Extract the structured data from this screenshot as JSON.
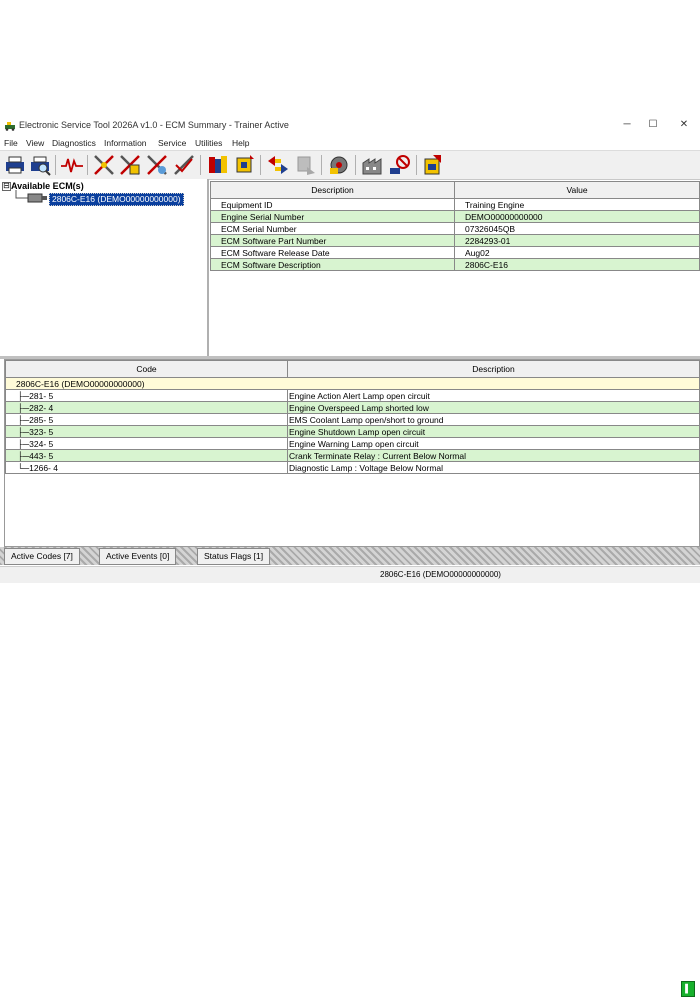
{
  "window": {
    "title": "Electronic Service Tool 2026A v1.0 - ECM Summary - Trainer Active",
    "min_glyph": "─",
    "max_glyph": "☐",
    "close_glyph": "✕"
  },
  "menu": [
    "File",
    "View",
    "Diagnostics",
    "Information",
    "Service",
    "Utilities",
    "Help"
  ],
  "toolbar_icons": [
    "printer-icon",
    "print-preview-icon",
    "waveform-icon",
    "diagnostic-tool-1-icon",
    "diagnostic-tool-2-icon",
    "diagnostic-tool-3-icon",
    "diagnostic-tool-4-icon",
    "books-icon",
    "chip-config-icon",
    "data-transfer-icon",
    "disabled-device-icon",
    "gear-settings-icon",
    "factory-icon",
    "no-entry-icon",
    "flash-file-icon"
  ],
  "tree": {
    "expander": "⊟",
    "root_label": "Available ECM(s)",
    "selected_label": "2806C-E16 (DEMO00000000000)"
  },
  "summary": {
    "headers": [
      "Description",
      "Value"
    ],
    "rows": [
      {
        "desc": "Equipment ID",
        "value": "Training Engine"
      },
      {
        "desc": "Engine Serial Number",
        "value": "DEMO00000000000"
      },
      {
        "desc": "ECM Serial Number",
        "value": "07326045QB"
      },
      {
        "desc": "ECM Software Part Number",
        "value": "2284293-01"
      },
      {
        "desc": "ECM Software Release Date",
        "value": "Aug02"
      },
      {
        "desc": "ECM Software Description",
        "value": "2806C-E16"
      }
    ]
  },
  "codes": {
    "headers": [
      "Code",
      "Description"
    ],
    "group": "2806C-E16 (DEMO00000000000)",
    "rows": [
      {
        "code": "281- 5",
        "desc": "Engine Action Alert Lamp open circuit"
      },
      {
        "code": "282- 4",
        "desc": "Engine Overspeed Lamp shorted low"
      },
      {
        "code": "285- 5",
        "desc": "EMS Coolant Lamp open/short to ground"
      },
      {
        "code": "323- 5",
        "desc": "Engine Shutdown Lamp open circuit"
      },
      {
        "code": "324- 5",
        "desc": "Engine Warning Lamp open circuit"
      },
      {
        "code": "443- 5",
        "desc": "Crank Terminate Relay : Current Below Normal"
      },
      {
        "code": "1266- 4",
        "desc": "Diagnostic Lamp : Voltage Below Normal"
      }
    ]
  },
  "tabs": [
    "Active Codes [7]",
    "Active Events [0]",
    "Status Flags [1]"
  ],
  "indicator_glyph": "▌",
  "status_text": "2806C-E16 (DEMO00000000000)",
  "colors": {
    "selection": "#0a3f9e",
    "row_green": "#d8f4d0",
    "row_yellow": "#fffbd8",
    "indicator": "#17b02c"
  }
}
